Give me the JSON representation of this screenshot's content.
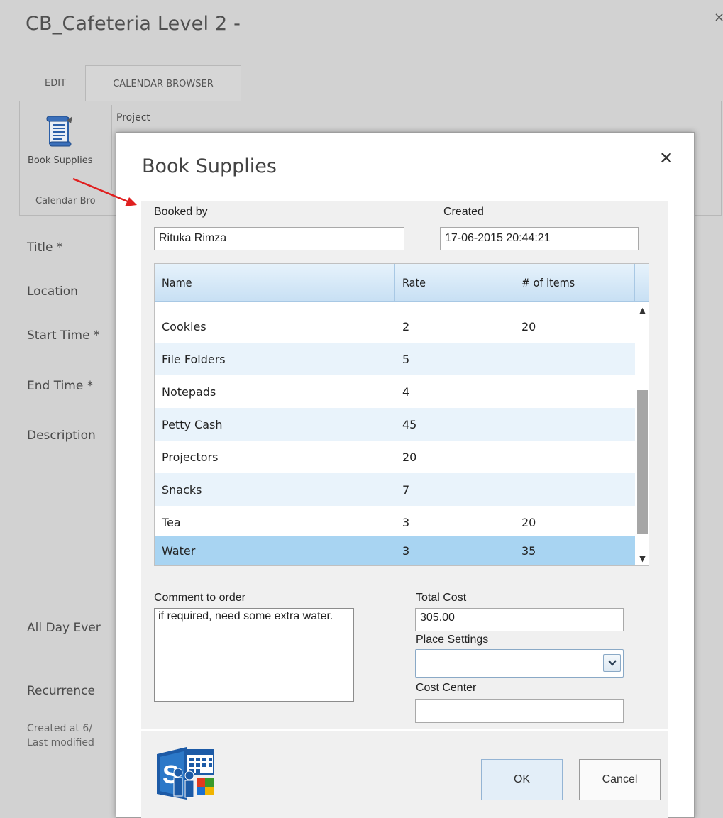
{
  "page": {
    "title": "CB_Cafeteria Level 2 -",
    "close_glyph": "×",
    "ribbon": {
      "tabs": [
        {
          "label": "EDIT"
        },
        {
          "label": "CALENDAR BROWSER"
        }
      ],
      "book_supplies_label": "Book Supplies",
      "project_label": "Project",
      "group_label": "Calendar Bro"
    },
    "form_labels": {
      "title": "Title *",
      "location": "Location",
      "start_time": "Start Time *",
      "end_time": "End Time *",
      "description": "Description",
      "all_day": "All Day Ever",
      "recurrence": "Recurrence"
    },
    "meta": {
      "created": "Created at 6/",
      "modified": "Last modified"
    }
  },
  "dialog": {
    "title": "Book Supplies",
    "close_glyph": "✕",
    "booked_by": {
      "label": "Booked by",
      "value": "Rituka  Rimza"
    },
    "created": {
      "label": "Created",
      "value": "17-06-2015 20:44:21"
    },
    "grid": {
      "columns": [
        "Name",
        "Rate",
        "# of items"
      ],
      "rows": [
        {
          "name": "Cookies",
          "rate": "2",
          "items": "20"
        },
        {
          "name": "File Folders",
          "rate": "5",
          "items": ""
        },
        {
          "name": "Notepads",
          "rate": "4",
          "items": ""
        },
        {
          "name": "Petty Cash",
          "rate": "45",
          "items": ""
        },
        {
          "name": "Projectors",
          "rate": "20",
          "items": ""
        },
        {
          "name": "Snacks",
          "rate": "7",
          "items": ""
        },
        {
          "name": "Tea",
          "rate": "3",
          "items": "20"
        },
        {
          "name": "Water",
          "rate": "3",
          "items": "35"
        }
      ],
      "selected_row": 7
    },
    "comment": {
      "label": "Comment to order",
      "value": "if required, need some extra water."
    },
    "total_cost": {
      "label": "Total Cost",
      "value": "305.00"
    },
    "place_settings": {
      "label": "Place Settings",
      "value": ""
    },
    "cost_center": {
      "label": "Cost Center",
      "value": ""
    },
    "buttons": {
      "ok": "OK",
      "cancel": "Cancel"
    }
  },
  "colors": {
    "grid_header": "#c8e0f4",
    "row_alt": "#e9f3fb",
    "row_selected": "#a8d4f2",
    "arrow": "#e02020",
    "ribbon_icon": "#2b5fa8"
  },
  "icons": [
    "book-supplies-scroll-icon",
    "close-icon",
    "scroll-up-icon",
    "scroll-down-icon",
    "dropdown-chevron-icon",
    "sharepoint-calendar-logo-icon"
  ]
}
